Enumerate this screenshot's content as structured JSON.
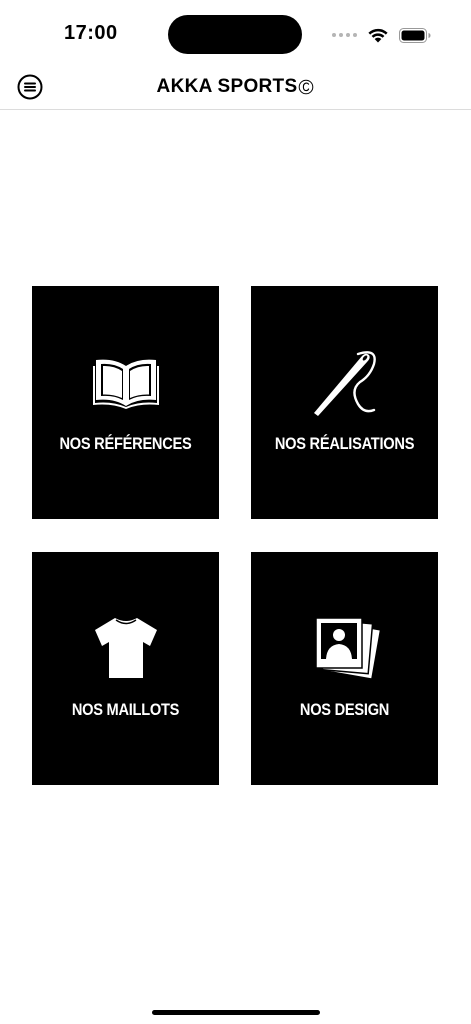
{
  "status_bar": {
    "time": "17:00"
  },
  "nav": {
    "brand": "AKKA SPORTS",
    "menu_icon": "hamburger-circle-icon",
    "logo_icon": "copyright-c-icon"
  },
  "tiles": [
    {
      "label": "NOS RÉFÉRENCES",
      "icon": "open-book-icon"
    },
    {
      "label": "NOS RÉALISATIONS",
      "icon": "sewing-needle-icon"
    },
    {
      "label": "NOS MAILLOTS",
      "icon": "tshirt-icon"
    },
    {
      "label": "NOS DESIGN",
      "icon": "photo-stack-icon"
    }
  ],
  "colors": {
    "tile_background": "#000000",
    "tile_text": "#ffffff",
    "page_background": "#ffffff"
  }
}
